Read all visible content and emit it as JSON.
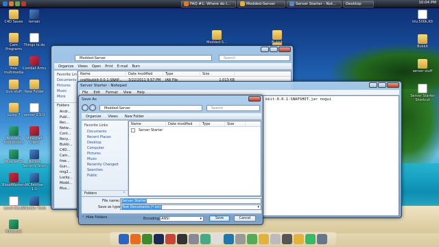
{
  "taskbar": {
    "items": [
      {
        "label": "FAQ #1: Where do I...",
        "icon_color": "#e07a2a"
      },
      {
        "label": "Modded-Server",
        "icon_color": "#e2b23c"
      },
      {
        "label": "Server Starter - Not...",
        "icon_color": "#5a86c4"
      },
      {
        "label": "Desktop",
        "icon_color": "#e2b23c"
      }
    ],
    "clock": "10:04 PM"
  },
  "desktop_icons_left": [
    {
      "label": "C4D Saves",
      "type": "folder"
    },
    {
      "label": "terrain",
      "type": "app3"
    },
    {
      "label": "Cam Programs",
      "type": "folder"
    },
    {
      "label": "Things to do",
      "type": "doc"
    },
    {
      "label": "free multimedia",
      "type": "folder"
    },
    {
      "label": "Combat Arms",
      "type": "app"
    },
    {
      "label": "Gun stuff",
      "type": "folder"
    },
    {
      "label": "New Folder",
      "type": "folder"
    },
    {
      "label": "Lucky 7",
      "type": "folder"
    },
    {
      "label": "server 1.5.0",
      "type": "doc"
    },
    {
      "label": "Bravado Productions",
      "type": "app2"
    },
    {
      "label": "Minecraft Client",
      "type": "app"
    },
    {
      "label": "Muscraft 5",
      "type": "app2"
    },
    {
      "label": "Norton Security Scan",
      "type": "app3"
    },
    {
      "label": "BloodMasters",
      "type": "app"
    },
    {
      "label": "MCPatcher 1.1",
      "type": "app3"
    },
    {
      "label": "Level-Stack",
      "type": "doc"
    },
    {
      "label": "Webdev Tools",
      "type": "app3"
    },
    {
      "label": "Minecraft",
      "type": "app2"
    }
  ],
  "desktop_icons_right": [
    {
      "label": "htv.500k.K0",
      "type": "doc"
    },
    {
      "label": "Bukkit",
      "type": "folder"
    },
    {
      "label": "server stuff",
      "type": "folder"
    },
    {
      "label": "Server Starter Shortcut",
      "type": "doc"
    }
  ],
  "desktop_icons_top": [
    {
      "label": "Modded-S...",
      "type": "folder"
    },
    {
      "label": "Bukkit",
      "type": "folder"
    },
    {
      "label": "Modded-Server",
      "type": "folder"
    }
  ],
  "explorer": {
    "address": "Modded-Server",
    "search_placeholder": "Search",
    "toolbar": [
      "Organize",
      "Views",
      "Open",
      "Print",
      "E-mail",
      "Burn"
    ],
    "favorites_header": "Favorite Links",
    "favorites": [
      "Documents",
      "Pictures",
      "Music",
      "More"
    ],
    "folders_header": "Folders",
    "folder_tree": [
      "Andr...",
      "Publ...",
      "Rec...",
      "Netw...",
      "Cont...",
      "Recy...",
      "Bukki...",
      "C4D...",
      "Cam...",
      "free...",
      "Gun...",
      "img2...",
      "Lucky...",
      "Modd...",
      "Mus..."
    ],
    "columns": [
      "Name",
      "Date modified",
      "Type",
      "Size"
    ],
    "rows": [
      {
        "name": "craftbukkit-0.0.1-SNAP...",
        "date": "3/22/2011 9:57 PM",
        "type": "JAR File",
        "size": "1,013 KB"
      }
    ]
  },
  "notepad": {
    "title": "Server Starter - Notepad",
    "menu": [
      "File",
      "Edit",
      "Format",
      "View",
      "Help"
    ],
    "content": "kkit-0.0.1-SNAPSHOT.jar nogui"
  },
  "save_dialog": {
    "title": "Save As",
    "address": "Modded-Server",
    "search_placeholder": "Search",
    "toolbar": [
      "Organize",
      "Views",
      "New Folder"
    ],
    "favorites_header": "Favorite Links",
    "favorites": [
      "Documents",
      "Recent Places",
      "Desktop",
      "Computer",
      "Pictures",
      "Music",
      "Recently Changed",
      "Searches",
      "Public"
    ],
    "folders_header": "Folders",
    "columns": [
      "Name",
      "Date modified",
      "Type",
      "Size"
    ],
    "files": [
      "Server Starter"
    ],
    "file_name_label": "File name:",
    "file_name_value": "Server Starter",
    "save_type_label": "Save as type:",
    "save_type_value": "Text Documents (*.txt)",
    "hide_folders": "Hide Folders",
    "encoding_label": "Encoding:",
    "encoding_value": "ANSI",
    "save_button": "Save",
    "cancel_button": "Cancel"
  },
  "colors": {
    "accent": "#3399ff",
    "folder_yellow": "#e2b23c",
    "link_blue": "#1a4fa0"
  }
}
